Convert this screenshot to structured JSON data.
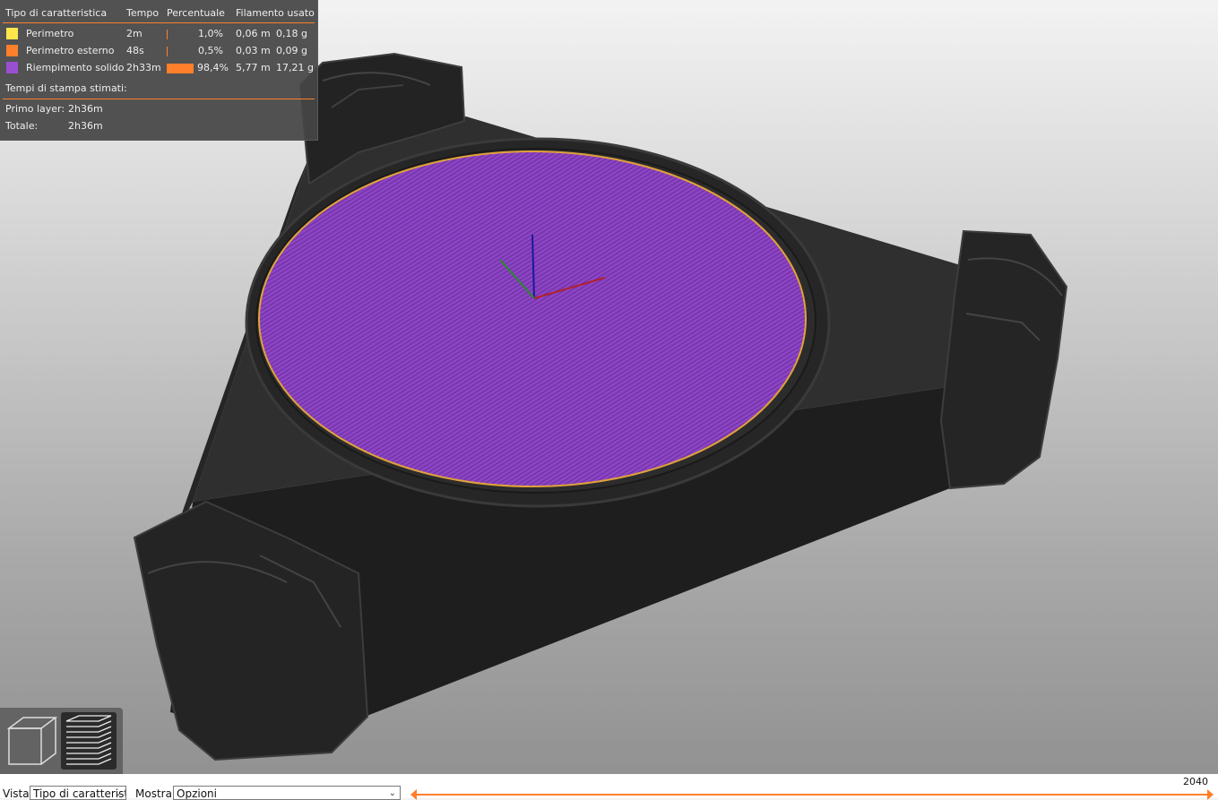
{
  "legend": {
    "headers": {
      "feature": "Tipo di caratteristica",
      "time": "Tempo",
      "percent": "Percentuale",
      "filament": "Filamento usato"
    },
    "rows": [
      {
        "name": "Perimetro",
        "color": "#ffe64a",
        "time": "2m",
        "percent": "1,0%",
        "percent_value": 1.0,
        "length": "0,06 m",
        "weight": "0,18 g"
      },
      {
        "name": "Perimetro esterno",
        "color": "#ff7f2a",
        "time": "48s",
        "percent": "0,5%",
        "percent_value": 0.5,
        "length": "0,03 m",
        "weight": "0,09 g"
      },
      {
        "name": "Riempimento solido",
        "color": "#9a4fd3",
        "time": "2h33m",
        "percent": "98,4%",
        "percent_value": 98.4,
        "length": "5,77 m",
        "weight": "17,21 g"
      }
    ],
    "estimated_title": "Tempi di stampa stimati:",
    "first_layer_label": "Primo layer:",
    "first_layer_value": "2h36m",
    "total_label": "Totale:",
    "total_value": "2h36m"
  },
  "view_buttons": [
    {
      "icon": "cube-3d-view-icon",
      "active": false
    },
    {
      "icon": "layers-preview-icon",
      "active": true
    }
  ],
  "bottom": {
    "view_label": "Vista",
    "view_value": "Tipo di caratteristica",
    "show_label": "Mostra",
    "show_value": "Opzioni",
    "slider_max": "2040"
  },
  "colors": {
    "accent": "#ff7f2a",
    "solid_infill": "#9a4fd3",
    "model_dark": "#2a2a2a"
  }
}
